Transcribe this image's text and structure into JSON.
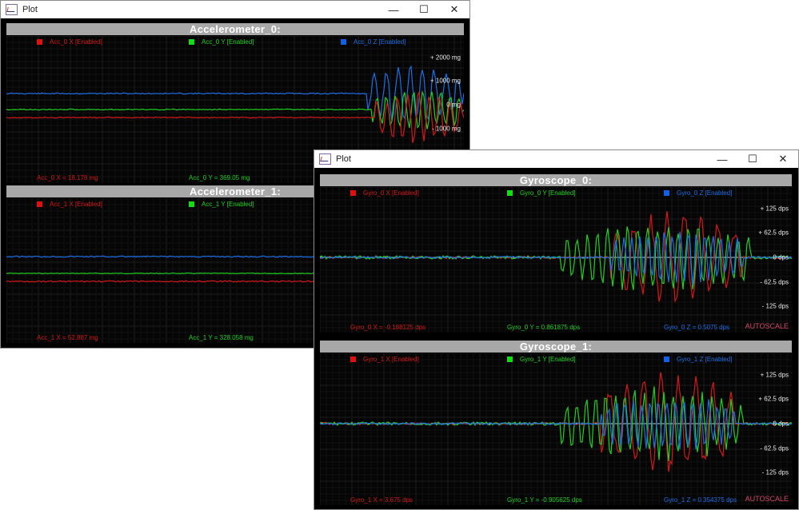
{
  "colors": {
    "x": "#d31818",
    "y": "#1fd11f",
    "z": "#1a6fe6"
  },
  "window_back": {
    "title": "Plot",
    "controls": [
      "—",
      "☐",
      "✕"
    ],
    "panes": [
      {
        "header": "Accelerometer_0:",
        "legend": [
          "Acc_0 X [Enabled]",
          "Acc_0 Y [Enabled]",
          "Acc_0 Z [Enabled]"
        ],
        "ticks": [
          "+ 2000 mg",
          "+ 1000 mg",
          "0 mg",
          "- 1000 mg"
        ],
        "readouts": [
          "Acc_0 X = 18.178 mg",
          "Acc_0 Y = 369.05 mg"
        ]
      },
      {
        "header": "Accelerometer_1:",
        "legend": [
          "Acc_1 X [Enabled]",
          "Acc_1 Y [Enabled]"
        ],
        "ticks": [],
        "readouts": [
          "Acc_1 X = 52.887 mg",
          "Acc_1 Y = 328.058 mg"
        ]
      }
    ]
  },
  "window_front": {
    "title": "Plot",
    "controls": [
      "—",
      "☐",
      "✕"
    ],
    "panes": [
      {
        "header": "Gyroscope_0:",
        "legend": [
          "Gyro_0 X [Enabled]",
          "Gyro_0 Y [Enabled]",
          "Gyro_0 Z [Enabled]"
        ],
        "ticks": [
          "+ 125 dps",
          "+ 62.5 dps",
          "0 dps",
          "- 62.5 dps",
          "- 125 dps"
        ],
        "readouts": [
          "Gyro_0 X = -0.188125 dps",
          "Gyro_0 Y = 0.861875 dps",
          "Gyro_0 Z = 0.5075 dps"
        ],
        "autoscale": "AUTOSCALE"
      },
      {
        "header": "Gyroscope_1:",
        "legend": [
          "Gyro_1 X [Enabled]",
          "Gyro_1 Y [Enabled]",
          "Gyro_1 Z [Enabled]"
        ],
        "ticks": [
          "+ 125 dps",
          "+ 62.5 dps",
          "0 dps",
          "- 62.5 dps",
          "- 125 dps"
        ],
        "readouts": [
          "Gyro_1 X = 3.675 dps",
          "Gyro_1 Y = -0.905625 dps",
          "Gyro_1 Z = 0.354375 dps"
        ],
        "autoscale": "AUTOSCALE"
      }
    ]
  }
}
